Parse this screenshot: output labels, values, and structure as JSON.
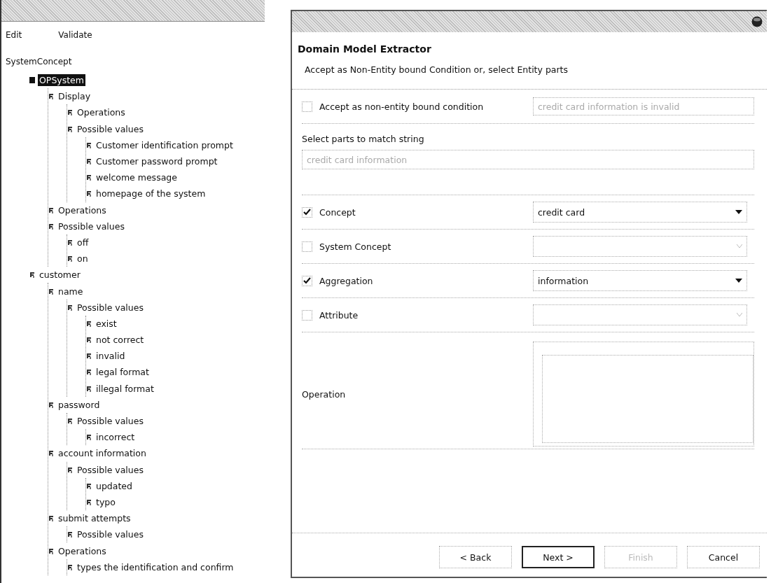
{
  "tree_window": {
    "menu": [
      {
        "label": "Edit"
      },
      {
        "label": "Validate"
      }
    ],
    "root_label": "SystemConcept",
    "tree": [
      {
        "label": "OPSystem",
        "selected": true,
        "children": [
          {
            "label": "Display",
            "selected": false,
            "children": [
              {
                "label": "Operations",
                "selected": false
              },
              {
                "label": "Possible values",
                "selected": false,
                "children": [
                  {
                    "label": "Customer identification prompt",
                    "selected": false
                  },
                  {
                    "label": "Customer password prompt",
                    "selected": false
                  },
                  {
                    "label": "welcome message",
                    "selected": false
                  },
                  {
                    "label": "homepage of the system",
                    "selected": false
                  }
                ]
              }
            ]
          },
          {
            "label": "Operations",
            "selected": false
          },
          {
            "label": "Possible values",
            "selected": false,
            "children": [
              {
                "label": "off",
                "selected": false
              },
              {
                "label": "on",
                "selected": false
              }
            ]
          }
        ]
      },
      {
        "label": "customer",
        "selected": false,
        "children": [
          {
            "label": "name",
            "selected": false,
            "children": [
              {
                "label": "Possible values",
                "selected": false,
                "children": [
                  {
                    "label": "exist",
                    "selected": false
                  },
                  {
                    "label": "not correct",
                    "selected": false
                  },
                  {
                    "label": "invalid",
                    "selected": false
                  },
                  {
                    "label": "legal format",
                    "selected": false
                  },
                  {
                    "label": "illegal format",
                    "selected": false
                  }
                ]
              }
            ]
          },
          {
            "label": "password",
            "selected": false,
            "children": [
              {
                "label": "Possible values",
                "selected": false,
                "children": [
                  {
                    "label": "incorrect",
                    "selected": false
                  }
                ]
              }
            ]
          },
          {
            "label": "account information",
            "selected": false,
            "children": [
              {
                "label": "Possible values",
                "selected": false,
                "children": [
                  {
                    "label": "updated",
                    "selected": false
                  },
                  {
                    "label": "typo",
                    "selected": false
                  }
                ]
              }
            ]
          },
          {
            "label": "submit attempts",
            "selected": false,
            "children": [
              {
                "label": "Possible values",
                "selected": false
              }
            ]
          },
          {
            "label": "Operations",
            "selected": false,
            "children": [
              {
                "label": "types the identification and confirm",
                "selected": false
              }
            ]
          }
        ]
      }
    ]
  },
  "dialog": {
    "heading": "Domain Model Extractor",
    "description": "Accept as Non-Entity bound Condition or, select Entity parts",
    "condition": {
      "label": "Accept as non-entity bound condition",
      "checked": false,
      "value": "credit card information is invalid",
      "disabled": true
    },
    "match": {
      "label": "Select parts to match string",
      "value": "credit card information",
      "disabled": true
    },
    "parts": [
      {
        "label": "Concept",
        "checked": true,
        "value": "credit card"
      },
      {
        "label": "System Concept",
        "checked": false
      },
      {
        "label": "Aggregation",
        "checked": true,
        "value": "information"
      },
      {
        "label": "Attribute",
        "checked": false
      }
    ],
    "operation": {
      "label": "Operation"
    },
    "buttons": [
      {
        "label": "< Back",
        "disabled": false,
        "default": false
      },
      {
        "label": "Next >",
        "disabled": false,
        "default": true
      },
      {
        "label": "Finish",
        "disabled": true,
        "default": false
      },
      {
        "label": "Cancel",
        "disabled": false,
        "default": false
      }
    ]
  }
}
